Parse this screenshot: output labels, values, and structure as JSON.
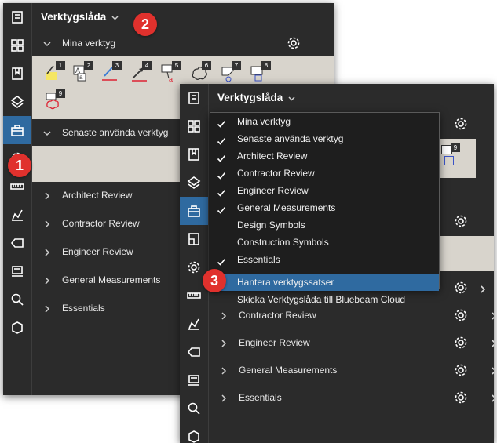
{
  "panel_back": {
    "title": "Verktygslåda",
    "sections": [
      {
        "label": "Mina verktyg",
        "expanded": true
      },
      {
        "label": "Senaste använda verktyg",
        "expanded": true
      },
      {
        "label": "Architect Review",
        "expanded": false
      },
      {
        "label": "Contractor Review",
        "expanded": false
      },
      {
        "label": "Engineer Review",
        "expanded": false
      },
      {
        "label": "General Measurements",
        "expanded": false
      },
      {
        "label": "Essentials",
        "expanded": false
      }
    ],
    "tool_badges": [
      "1",
      "2",
      "3",
      "4",
      "5",
      "6",
      "7",
      "8",
      "9"
    ]
  },
  "panel_front": {
    "title": "Verktygslåda",
    "sections": [
      {
        "label": "Contractor Review"
      },
      {
        "label": "Engineer Review"
      },
      {
        "label": "General Measurements"
      },
      {
        "label": "Essentials"
      }
    ],
    "badge": "9"
  },
  "dropdown": {
    "items": [
      {
        "label": "Mina verktyg",
        "checked": true
      },
      {
        "label": "Senaste använda verktyg",
        "checked": true
      },
      {
        "label": "Architect Review",
        "checked": true
      },
      {
        "label": "Contractor Review",
        "checked": true
      },
      {
        "label": "Engineer Review",
        "checked": true
      },
      {
        "label": "General Measurements",
        "checked": true
      },
      {
        "label": "Design Symbols",
        "checked": false
      },
      {
        "label": "Construction Symbols",
        "checked": false
      },
      {
        "label": "Essentials",
        "checked": true
      }
    ],
    "actions": [
      {
        "label": "Hantera verktygssatser",
        "highlighted": true
      },
      {
        "label": "Skicka Verktygslåda till Bluebeam Cloud",
        "highlighted": false
      }
    ]
  },
  "callouts": [
    "1",
    "2",
    "3"
  ],
  "colors": {
    "panel_bg": "#2b2b2b",
    "active_blue": "#2f6aa0",
    "callout_red": "#e0312d",
    "tool_area": "#d8d4cc"
  }
}
